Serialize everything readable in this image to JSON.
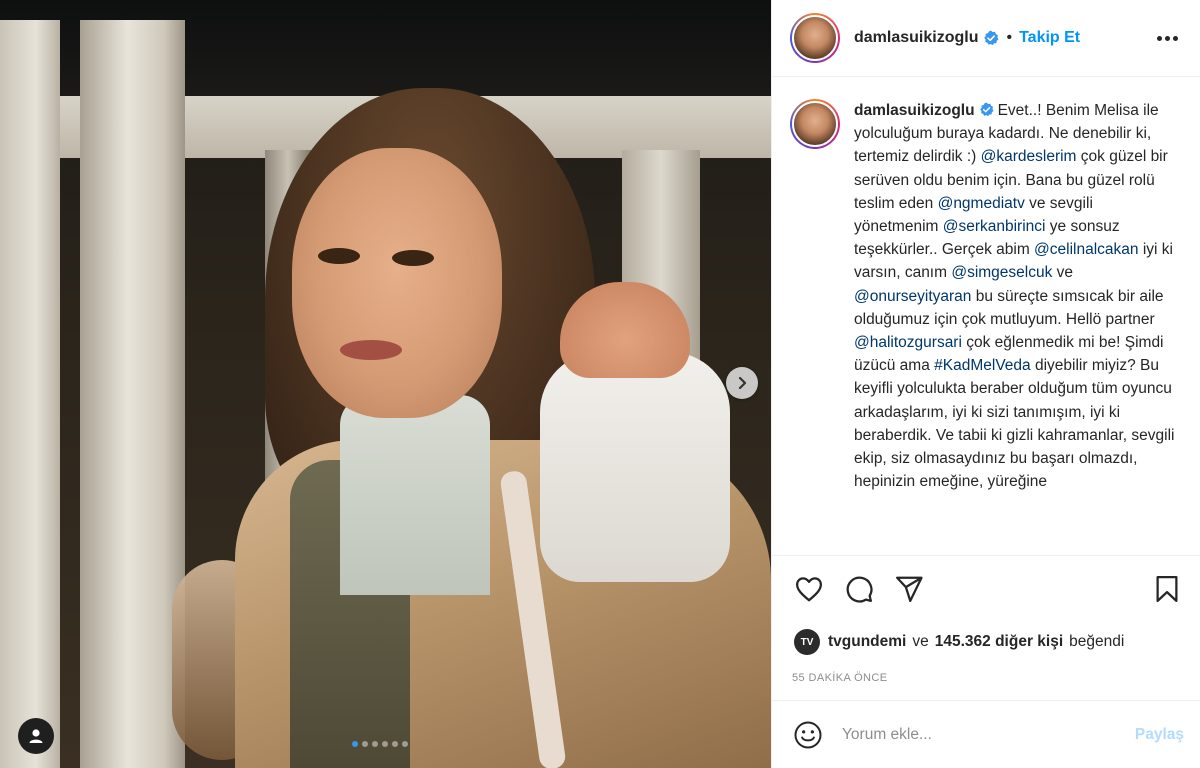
{
  "header": {
    "username": "damlasuikizoglu",
    "separator": "•",
    "follow_label": "Takip Et"
  },
  "caption": {
    "username": "damlasuikizoglu",
    "segments": [
      {
        "t": "Evet..! Benim Melisa ile yolculuğum buraya kadardı. Ne denebilir ki, tertemiz delirdik :) "
      },
      {
        "m": "@kardeslerim"
      },
      {
        "t": " çok güzel bir serüven oldu benim için. Bana bu güzel rolü teslim eden "
      },
      {
        "m": "@ngmediatv"
      },
      {
        "t": " ve sevgili yönetmenim "
      },
      {
        "m": "@serkanbirinci"
      },
      {
        "t": " ye sonsuz teşekkürler.. Gerçek abim "
      },
      {
        "m": "@celilnalcakan"
      },
      {
        "t": " iyi ki varsın, canım "
      },
      {
        "m": "@simgeselcuk"
      },
      {
        "t": " ve "
      },
      {
        "m": "@onurseyityaran"
      },
      {
        "t": " bu süreçte sımsıcak bir aile olduğumuz için çok mutluyum. Hellö partner "
      },
      {
        "m": "@halitozgursari"
      },
      {
        "t": " çok eğlenmedik mi be! Şimdi üzücü ama "
      },
      {
        "m": "#KadMelVeda"
      },
      {
        "t": " diyebilir miyiz? Bu keyifli yolculukta beraber olduğum tüm oyuncu arkadaşlarım, iyi ki sizi tanımışım, iyi ki beraberdik. Ve tabii ki gizli kahramanlar, sevgili ekip, siz olmasaydınız bu başarı olmazdı, hepinizin emeğine, yüreğine"
      }
    ]
  },
  "likes": {
    "avatar_text": "TV",
    "liker": "tvgundemi",
    "connector": "ve",
    "others": "145.362 diğer kişi",
    "suffix": "beğendi"
  },
  "time_ago": "55 DAKİKA ÖNCE",
  "comment": {
    "placeholder": "Yorum ekle...",
    "share_label": "Paylaş"
  },
  "carousel": {
    "total": 6,
    "active_index": 0
  },
  "icons": {
    "verified": "verified-badge-icon",
    "more": "more-options-icon",
    "like": "heart-icon",
    "comment": "comment-bubble-icon",
    "share": "paper-plane-icon",
    "save": "bookmark-icon",
    "emoji": "smiley-icon",
    "next": "chevron-right-icon",
    "tag": "user-tag-icon"
  },
  "colors": {
    "accent": "#0095f6",
    "mention": "#00376b",
    "muted": "#8e8e8e",
    "share_disabled": "#b3dbff",
    "verified": "#3897f0"
  }
}
